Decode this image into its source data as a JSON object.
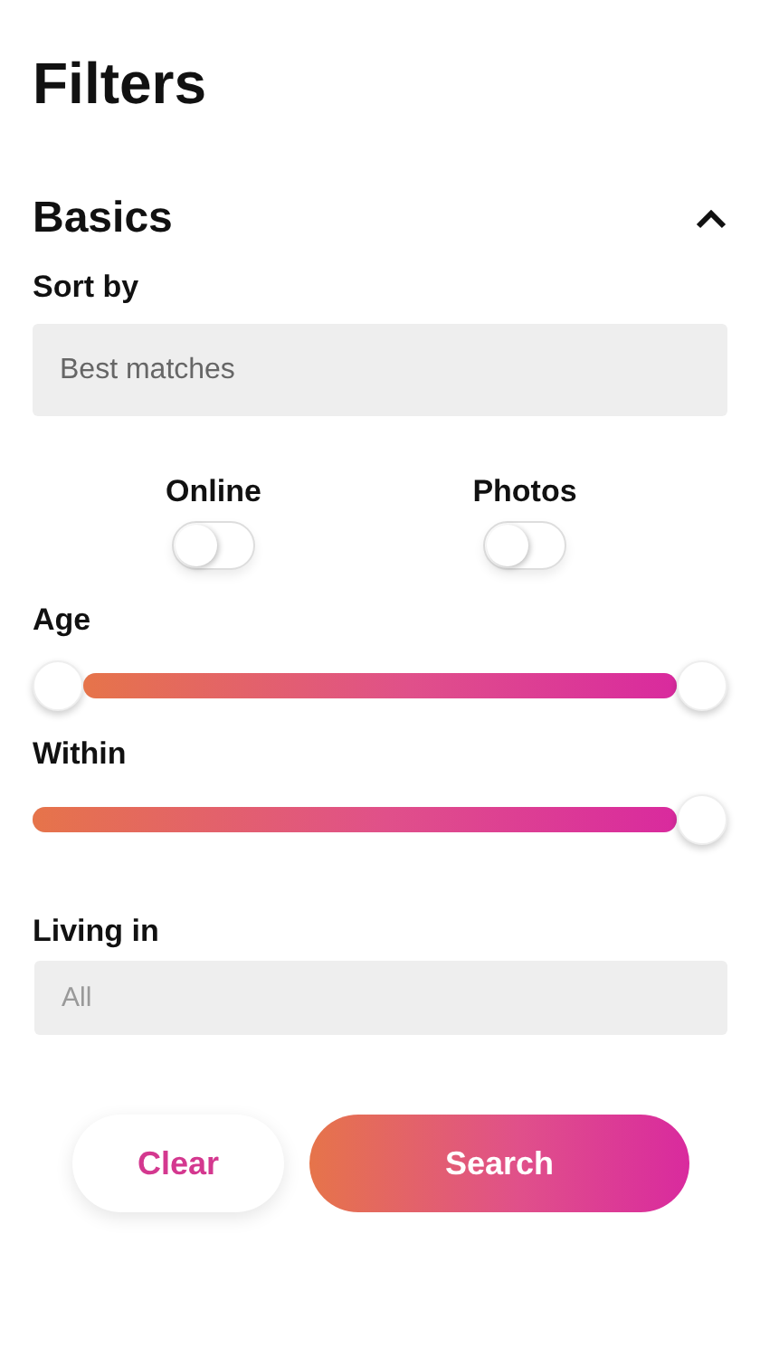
{
  "title": "Filters",
  "section": {
    "title": "Basics",
    "expanded": true
  },
  "sort_by": {
    "label": "Sort by",
    "value": "Best matches"
  },
  "toggles": [
    {
      "label": "Online",
      "on": false
    },
    {
      "label": "Photos",
      "on": false
    }
  ],
  "sliders": [
    {
      "label": "Age",
      "kind": "range",
      "level": 1
    },
    {
      "label": "Within",
      "kind": "single",
      "level": 1
    }
  ],
  "living_in": {
    "label": "Living in",
    "placeholder": "All"
  },
  "buttons": [
    {
      "label": "Clear",
      "kind": "secondary"
    },
    {
      "label": "Search",
      "kind": "primary"
    }
  ]
}
